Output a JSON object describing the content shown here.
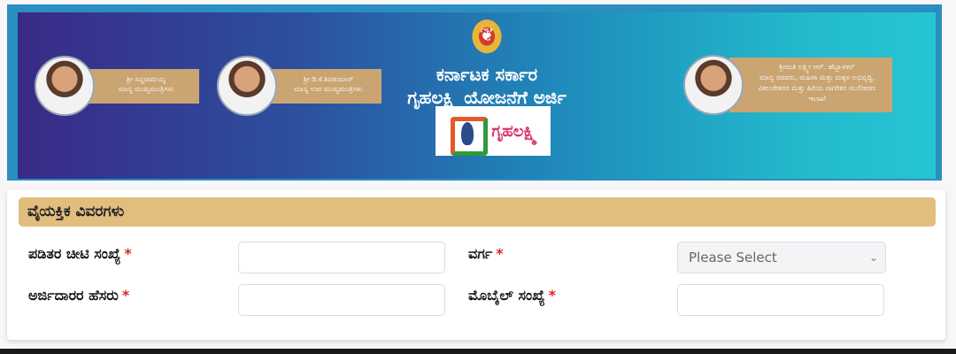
{
  "banner": {
    "emblem_icon": "karnataka-emblem-icon",
    "title_line1": "ಕರ್ನಾಟಕ ಸರ್ಕಾರ",
    "title_line2": "ಗೃಹಲಕ್ಷ್ಮಿ ಯೋಜನೆಗೆ ಅರ್ಜಿ",
    "logo_text": "ಗೃಹಲಕ್ಷ್ಮಿ",
    "people": [
      {
        "name": "ಶ್ರೀ ಸಿದ್ದರಾಮಯ್ಯ",
        "role": "ಮಾನ್ಯ ಮುಖ್ಯಮಂತ್ರಿಗಳು"
      },
      {
        "name": "ಶ್ರೀ ಡಿ.ಕೆ.ಶಿವಕುಮಾರ್",
        "role": "ಮಾನ್ಯ ಉಪ ಮುಖ್ಯಮಂತ್ರಿಗಳು"
      },
      {
        "name": "ಶ್ರೀಮತಿ ಲಕ್ಷ್ಮೀ ಆರ್. ಹೆಬ್ಬಾಳಕರ್",
        "role": "ಮಾನ್ಯ ಸಚಿವರು, ಮಹಿಳಾ ಮತ್ತು ಮಕ್ಕಳ ಅಭಿವೃದ್ಧಿ, ವಿಕಲಚೇತನರ ಮತ್ತು ಹಿರಿಯ ನಾಗರಿಕರ ಸಬಲೀಕರಣ ಇಲಾಖೆ"
      }
    ]
  },
  "form": {
    "section_title": "ವೈಯಕ್ತಿಕ ವಿವರಗಳು",
    "required_mark": "*",
    "fields": {
      "ration_card": {
        "label": "ಪಡಿತರ ಚೀಟಿ ಸಂಖ್ಯೆ",
        "value": ""
      },
      "category": {
        "label": "ವರ್ಗ",
        "selected": "Please Select"
      },
      "applicant_name": {
        "label": "ಅರ್ಜಿದಾರರ ಹೆಸರು",
        "value": ""
      },
      "mobile": {
        "label": "ಮೊಬೈಲ್ ಸಂಖ್ಯೆ",
        "value": ""
      }
    }
  }
}
